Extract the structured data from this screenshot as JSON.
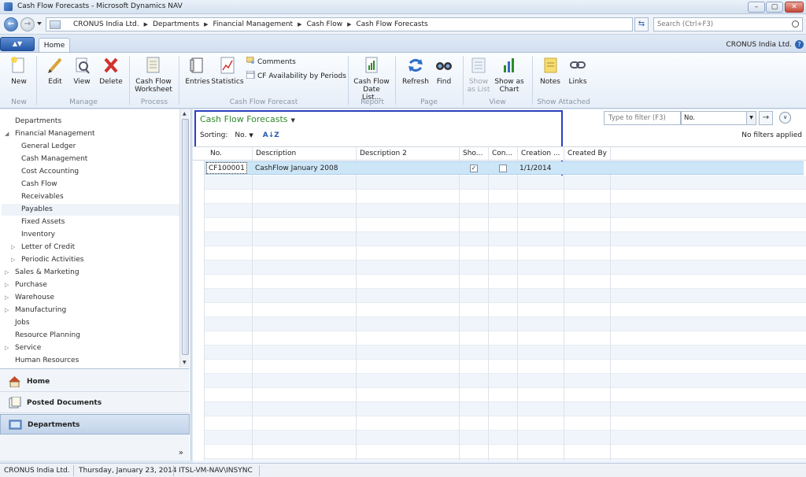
{
  "window": {
    "title": "Cash Flow Forecasts - Microsoft Dynamics NAV",
    "minimize": "–",
    "maximize": "▢",
    "close": "✕"
  },
  "address": {
    "crumbs": [
      "CRONUS India Ltd.",
      "Departments",
      "Financial Management",
      "Cash Flow",
      "Cash Flow Forecasts"
    ],
    "search_placeholder": "Search (Ctrl+F3)"
  },
  "ribbon_tabs": {
    "home": "Home",
    "company": "CRONUS India Ltd.",
    "help": "?"
  },
  "ribbon": {
    "new": "New",
    "edit": "Edit",
    "view": "View",
    "delete": "Delete",
    "cash_flow_worksheet_1": "Cash Flow",
    "cash_flow_worksheet_2": "Worksheet",
    "entries": "Entries",
    "statistics": "Statistics",
    "comments": "Comments",
    "cf_availability": "CF Availability by Periods",
    "date_list_1": "Cash Flow",
    "date_list_2": "Date List...",
    "refresh": "Refresh",
    "find": "Find",
    "show_as_list_1": "Show",
    "show_as_list_2": "as List",
    "show_as_chart_1": "Show as",
    "show_as_chart_2": "Chart",
    "notes": "Notes",
    "links": "Links",
    "groups": {
      "new": "New",
      "manage": "Manage",
      "process": "Process",
      "cash_flow_forecast": "Cash Flow Forecast",
      "report": "Report",
      "page": "Page",
      "view": "View",
      "show_attached": "Show Attached"
    }
  },
  "nav": {
    "items": [
      {
        "label": "Departments"
      },
      {
        "label": "Financial Management"
      },
      {
        "label": "General Ledger"
      },
      {
        "label": "Cash Management"
      },
      {
        "label": "Cost Accounting"
      },
      {
        "label": "Cash Flow"
      },
      {
        "label": "Receivables"
      },
      {
        "label": "Payables"
      },
      {
        "label": "Fixed Assets"
      },
      {
        "label": "Inventory"
      },
      {
        "label": "Letter of Credit"
      },
      {
        "label": "Periodic Activities"
      },
      {
        "label": "Sales & Marketing"
      },
      {
        "label": "Purchase"
      },
      {
        "label": "Warehouse"
      },
      {
        "label": "Manufacturing"
      },
      {
        "label": "Jobs"
      },
      {
        "label": "Resource Planning"
      },
      {
        "label": "Service"
      },
      {
        "label": "Human Resources"
      }
    ],
    "buttons": {
      "home": "Home",
      "posted_documents": "Posted Documents",
      "departments": "Departments"
    },
    "more": "»"
  },
  "page": {
    "title": "Cash Flow Forecasts",
    "sorting_label": "Sorting:",
    "sorting_field": "No.",
    "filter_placeholder": "Type to filter (F3)",
    "filter_field": "No.",
    "no_filters": "No filters applied"
  },
  "grid": {
    "columns": [
      "No.",
      "Description",
      "Description 2",
      "Sho...",
      "Con...",
      "Creation ...",
      "Created By"
    ],
    "rows": [
      {
        "no": "CF100001",
        "description": "CashFlow January 2008",
        "description2": "",
        "show": true,
        "consider": false,
        "creation": "1/1/2014",
        "created_by": ""
      }
    ]
  },
  "status": {
    "company": "CRONUS India Ltd.",
    "date": "Thursday, January 23, 2014",
    "user": "ITSL-VM-NAV\\INSYNC"
  }
}
